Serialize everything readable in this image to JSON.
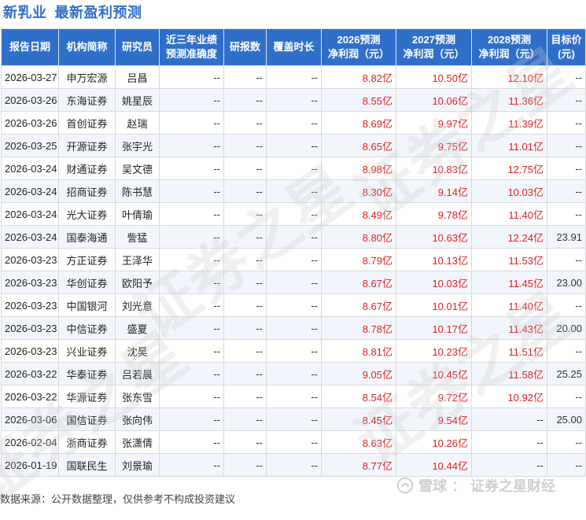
{
  "title": {
    "stock": "新乳业",
    "subtitle": "最新盈利预测"
  },
  "table": {
    "headers": [
      [
        "报告日期"
      ],
      [
        "机构简称"
      ],
      [
        "研究员"
      ],
      [
        "近三年业绩",
        "预测准确度"
      ],
      [
        "研报数"
      ],
      [
        "覆盖时长"
      ],
      [
        "2026预测",
        "净利润（元）"
      ],
      [
        "2027预测",
        "净利润（元）"
      ],
      [
        "2028预测",
        "净利润（元）"
      ],
      [
        "目标价",
        "(元)"
      ]
    ],
    "rows": [
      {
        "date": "2026-03-27",
        "inst": "申万宏源",
        "analyst": "吕昌",
        "accuracy": "--",
        "reports": "--",
        "coverage": "--",
        "p2026": "8.82亿",
        "p2027": "10.50亿",
        "p2028": "12.10亿",
        "target": "--"
      },
      {
        "date": "2026-03-26",
        "inst": "东海证券",
        "analyst": "姚星辰",
        "accuracy": "--",
        "reports": "--",
        "coverage": "--",
        "p2026": "8.55亿",
        "p2027": "10.06亿",
        "p2028": "11.36亿",
        "target": "--"
      },
      {
        "date": "2026-03-26",
        "inst": "首创证券",
        "analyst": "赵瑞",
        "accuracy": "--",
        "reports": "--",
        "coverage": "--",
        "p2026": "8.69亿",
        "p2027": "9.97亿",
        "p2028": "11.39亿",
        "target": "--"
      },
      {
        "date": "2026-03-25",
        "inst": "开源证券",
        "analyst": "张宇光",
        "accuracy": "--",
        "reports": "--",
        "coverage": "--",
        "p2026": "8.65亿",
        "p2027": "9.75亿",
        "p2028": "11.01亿",
        "target": "--"
      },
      {
        "date": "2026-03-24",
        "inst": "财通证券",
        "analyst": "吴文德",
        "accuracy": "--",
        "reports": "--",
        "coverage": "--",
        "p2026": "8.98亿",
        "p2027": "10.83亿",
        "p2028": "12.75亿",
        "target": "--"
      },
      {
        "date": "2026-03-24",
        "inst": "招商证券",
        "analyst": "陈书慧",
        "accuracy": "--",
        "reports": "--",
        "coverage": "--",
        "p2026": "8.30亿",
        "p2027": "9.14亿",
        "p2028": "10.03亿",
        "target": "--"
      },
      {
        "date": "2026-03-24",
        "inst": "光大证券",
        "analyst": "叶倩瑜",
        "accuracy": "--",
        "reports": "--",
        "coverage": "--",
        "p2026": "8.49亿",
        "p2027": "9.78亿",
        "p2028": "11.40亿",
        "target": "--"
      },
      {
        "date": "2026-03-24",
        "inst": "国泰海通",
        "analyst": "訾猛",
        "accuracy": "--",
        "reports": "--",
        "coverage": "--",
        "p2026": "8.80亿",
        "p2027": "10.63亿",
        "p2028": "12.24亿",
        "target": "23.91"
      },
      {
        "date": "2026-03-23",
        "inst": "方正证券",
        "analyst": "王泽华",
        "accuracy": "--",
        "reports": "--",
        "coverage": "--",
        "p2026": "8.79亿",
        "p2027": "10.13亿",
        "p2028": "11.53亿",
        "target": "--"
      },
      {
        "date": "2026-03-23",
        "inst": "华创证券",
        "analyst": "欧阳予",
        "accuracy": "--",
        "reports": "--",
        "coverage": "--",
        "p2026": "8.67亿",
        "p2027": "10.03亿",
        "p2028": "11.45亿",
        "target": "23.00"
      },
      {
        "date": "2026-03-23",
        "inst": "中国银河",
        "analyst": "刘光意",
        "accuracy": "--",
        "reports": "--",
        "coverage": "--",
        "p2026": "8.67亿",
        "p2027": "10.01亿",
        "p2028": "11.40亿",
        "target": "--"
      },
      {
        "date": "2026-03-23",
        "inst": "中信证券",
        "analyst": "盛夏",
        "accuracy": "--",
        "reports": "--",
        "coverage": "--",
        "p2026": "8.78亿",
        "p2027": "10.17亿",
        "p2028": "11.43亿",
        "target": "20.00"
      },
      {
        "date": "2026-03-23",
        "inst": "兴业证券",
        "analyst": "沈昊",
        "accuracy": "--",
        "reports": "--",
        "coverage": "--",
        "p2026": "8.81亿",
        "p2027": "10.23亿",
        "p2028": "11.51亿",
        "target": "--"
      },
      {
        "date": "2026-03-22",
        "inst": "华泰证券",
        "analyst": "吕若晨",
        "accuracy": "--",
        "reports": "--",
        "coverage": "--",
        "p2026": "9.05亿",
        "p2027": "10.45亿",
        "p2028": "11.58亿",
        "target": "25.25"
      },
      {
        "date": "2026-03-22",
        "inst": "华源证券",
        "analyst": "张东雪",
        "accuracy": "--",
        "reports": "--",
        "coverage": "--",
        "p2026": "8.54亿",
        "p2027": "9.72亿",
        "p2028": "10.92亿",
        "target": "--"
      },
      {
        "date": "2026-03-06",
        "inst": "国信证券",
        "analyst": "张向伟",
        "accuracy": "--",
        "reports": "--",
        "coverage": "--",
        "p2026": "8.45亿",
        "p2027": "9.54亿",
        "p2028": "--",
        "target": "25.00"
      },
      {
        "date": "2026-02-04",
        "inst": "浙商证券",
        "analyst": "张潇倩",
        "accuracy": "--",
        "reports": "--",
        "coverage": "--",
        "p2026": "8.63亿",
        "p2027": "10.26亿",
        "p2028": "--",
        "target": "--"
      },
      {
        "date": "2026-01-19",
        "inst": "国联民生",
        "analyst": "刘景瑜",
        "accuracy": "--",
        "reports": "--",
        "coverage": "--",
        "p2026": "8.77亿",
        "p2027": "10.44亿",
        "p2028": "--",
        "target": "--"
      }
    ]
  },
  "footer": {
    "source_note": "数据来源：公开数据整理，仅供参考不构成投资建议"
  },
  "brand": {
    "snowball": "雪球",
    "separator": "：",
    "name": "证券之星财经"
  },
  "watermark": {
    "text": "证券之星"
  },
  "colors": {
    "header_bg": "#2f6fc9",
    "title": "#2f6fc9",
    "forecast_text": "#e02020",
    "row_alt": "#f2f6fc"
  },
  "icons": {
    "brand_logo": "snowball-logo-icon"
  }
}
